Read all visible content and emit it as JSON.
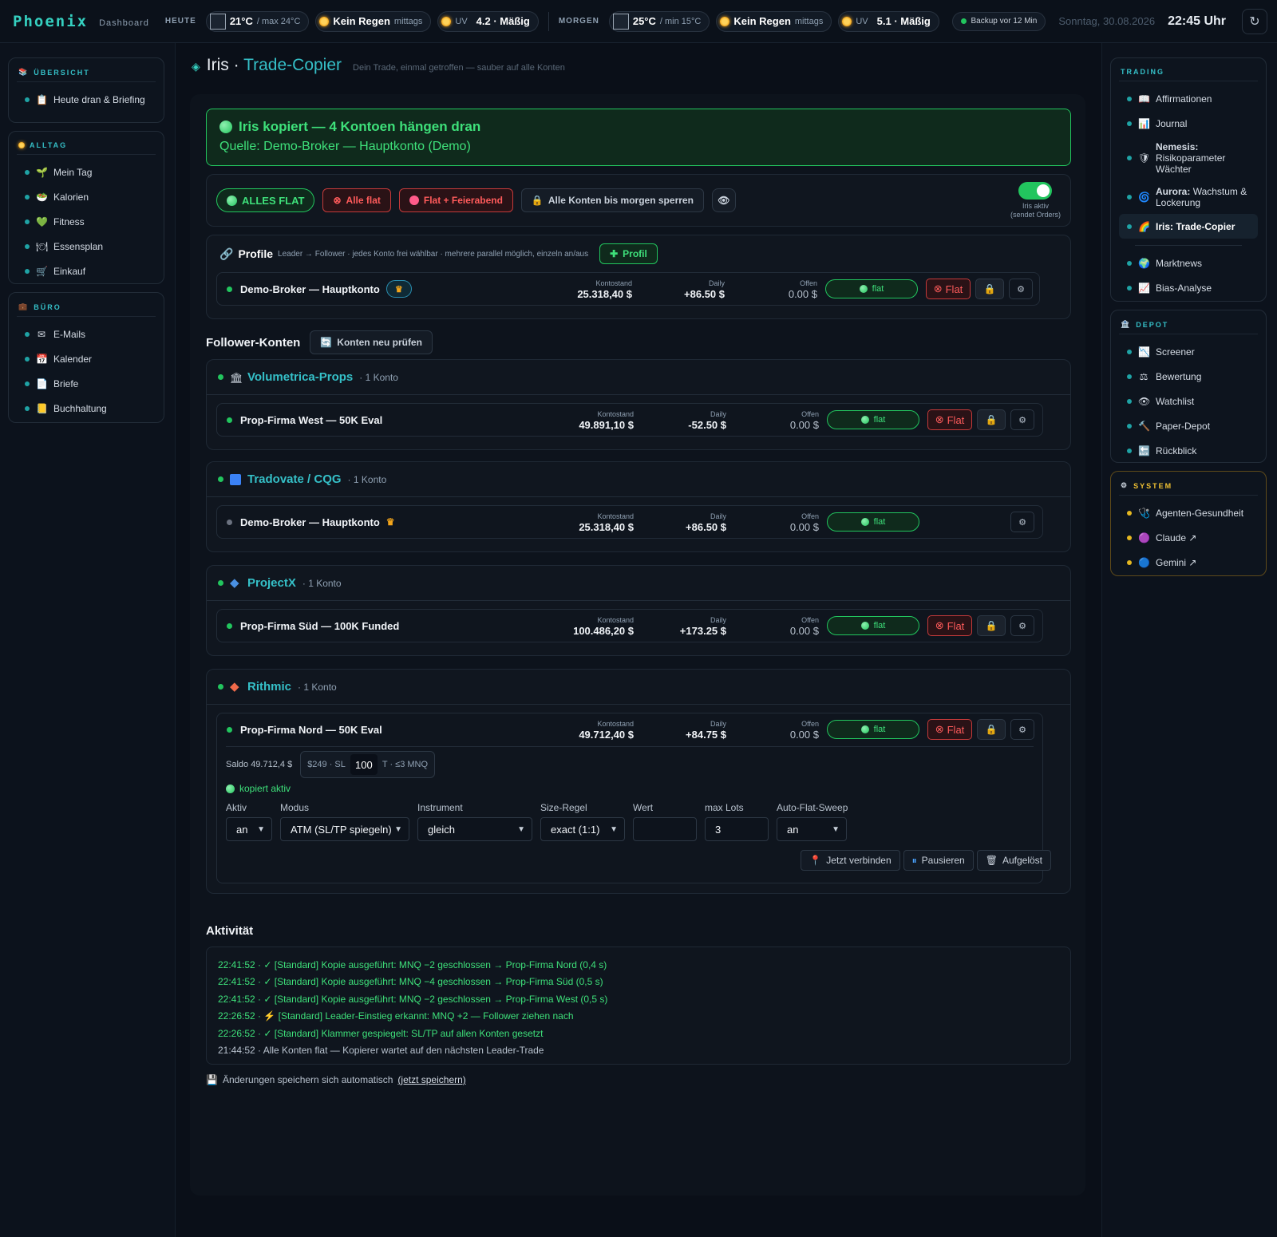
{
  "topbar": {
    "logo": "Phoenix",
    "logo_sub": "Dashboard",
    "today_label": "HEUTE",
    "today_temp": "21°C",
    "today_temp_sub": "/ max 24°C",
    "today_rain": "Kein Regen",
    "today_rain_sub": "mittags",
    "today_uv_label": "UV",
    "today_uv": "4.2 · Mäßig",
    "tomorrow_label": "MORGEN",
    "tomorrow_temp": "25°C",
    "tomorrow_temp_sub": "/ min 15°C",
    "tomorrow_rain": "Kein Regen",
    "tomorrow_rain_sub": "mittags",
    "tomorrow_uv_label": "UV",
    "tomorrow_uv": "5.1 · Mäßig",
    "backup": "Backup vor 12 Min",
    "date": "Sonntag, 30.08.2026",
    "time": "22:45 Uhr",
    "refresh_icon": "↻"
  },
  "left_nav": {
    "overview": {
      "title": "ÜBERSICHT",
      "items": [
        {
          "icon": "📋",
          "label": "Heute dran & Briefing"
        }
      ]
    },
    "alltag": {
      "title": "ALLTAG",
      "items": [
        {
          "icon": "🌱",
          "label": "Mein Tag"
        },
        {
          "icon": "🥗",
          "label": "Kalorien"
        },
        {
          "icon": "💚",
          "label": "Fitness"
        },
        {
          "icon": "🍽",
          "label": "Essensplan"
        },
        {
          "icon": "🛒",
          "label": "Einkauf"
        }
      ]
    },
    "buero": {
      "title": "BÜRO",
      "items": [
        {
          "icon": "✉",
          "label": "E-Mails"
        },
        {
          "icon": "📅",
          "label": "Kalender"
        },
        {
          "icon": "📄",
          "label": "Briefe"
        },
        {
          "icon": "📒",
          "label": "Buchhaltung"
        }
      ]
    }
  },
  "right_nav": {
    "trading": {
      "title": "TRADING",
      "items": [
        {
          "icon": "📖",
          "label": "Affirmationen",
          "bold": ""
        },
        {
          "icon": "📊",
          "label": "Journal",
          "bold": ""
        },
        {
          "icon": "🛡",
          "bold": "Nemesis:",
          "label": "Risikoparameter Wächter"
        },
        {
          "icon": "🌀",
          "bold": "Aurora:",
          "label": "Wachstum & Lockerung"
        },
        {
          "icon": "🌈",
          "bold": "Iris:",
          "label": "Trade-Copier"
        },
        {
          "icon": "🌍",
          "label": "Marktnews",
          "bold": ""
        },
        {
          "icon": "📈",
          "label": "Bias-Analyse",
          "bold": ""
        }
      ]
    },
    "depot": {
      "title": "DEPOT",
      "items": [
        {
          "icon": "📉",
          "label": "Screener"
        },
        {
          "icon": "⚖",
          "label": "Bewertung"
        },
        {
          "icon": "👁",
          "label": "Watchlist"
        },
        {
          "icon": "🔨",
          "label": "Paper-Depot"
        },
        {
          "icon": "🔙",
          "label": "Rückblick"
        }
      ]
    },
    "system": {
      "title": "SYSTEM",
      "items": [
        {
          "icon": "🩺",
          "label": "Agenten-Gesundheit"
        },
        {
          "icon": "🟣",
          "label": "Claude ↗"
        },
        {
          "icon": "🔵",
          "label": "Gemini ↗"
        }
      ]
    }
  },
  "page": {
    "title_prefix": "Iris ·",
    "title_main": "Trade-Copier",
    "subtitle": "Dein Trade, einmal getroffen — sauber auf alle Konten"
  },
  "banner": {
    "line1": "Iris kopiert — 4 Kontoen hängen dran",
    "line2": "Quelle: Demo-Broker — Hauptkonto (Demo)"
  },
  "actions": {
    "alles_flat": "ALLES FLAT",
    "alle_flat": "Alle flat",
    "flat_feierabend": "Flat + Feierabend",
    "sperren": "Alle Konten bis morgen sperren",
    "toggle_label1": "Iris aktiv",
    "toggle_label2": "(sendet Orders)"
  },
  "profile": {
    "title": "Profile",
    "desc": "Leader → Follower · jedes Konto frei wählbar · mehrere parallel möglich, einzeln an/aus",
    "add": "Profil",
    "leader": {
      "name": "Demo-Broker — Hauptkonto",
      "balance": "25.318,40 $",
      "daily": "+86.50 $",
      "open": "0.00 $"
    }
  },
  "labels": {
    "kontostand": "Kontostand",
    "daily": "Daily",
    "offen": "Offen",
    "flat_chip": "flat",
    "flat_btn": "Flat",
    "lock": "🔒",
    "gear": "⚙"
  },
  "followers": {
    "title": "Follower-Konten",
    "recheck": "Konten neu prüfen",
    "groups": [
      {
        "name": "Volumetrica-Props",
        "count": "· 1 Konto",
        "account": {
          "name": "Prop-Firma West — 50K Eval",
          "balance": "49.891,10 $",
          "daily": "-52.50 $",
          "open": "0.00 $"
        }
      },
      {
        "name": "Tradovate / CQG",
        "count": "· 1 Konto",
        "account": {
          "name": "Demo-Broker — Hauptkonto",
          "balance": "25.318,40 $",
          "daily": "+86.50 $",
          "open": "0.00 $"
        }
      },
      {
        "name": "ProjectX",
        "count": "· 1 Konto",
        "account": {
          "name": "Prop-Firma Süd — 100K Funded",
          "balance": "100.486,20 $",
          "daily": "+173.25 $",
          "open": "0.00 $"
        }
      },
      {
        "name": "Rithmic",
        "count": "· 1 Konto",
        "account": {
          "name": "Prop-Firma Nord — 50K Eval",
          "balance": "49.712,40 $",
          "daily": "+84.75 $",
          "open": "0.00 $"
        }
      }
    ]
  },
  "detail": {
    "saldo": "Saldo 49.712,4 $",
    "sl_prefix": "$249 · SL",
    "sl_value": "100",
    "sl_suffix": "T · ≤3 MNQ",
    "kopiert": "kopiert aktiv",
    "fields": {
      "aktiv": {
        "label": "Aktiv",
        "value": "an"
      },
      "modus": {
        "label": "Modus",
        "value": "ATM (SL/TP spiegeln)"
      },
      "instrument": {
        "label": "Instrument",
        "value": "gleich"
      },
      "size": {
        "label": "Size-Regel",
        "value": "exact (1:1)"
      },
      "wert": {
        "label": "Wert",
        "value": ""
      },
      "maxlots": {
        "label": "max Lots",
        "value": "3"
      },
      "sweep": {
        "label": "Auto-Flat-Sweep",
        "value": "an"
      }
    },
    "buttons": {
      "connect": "Jetzt verbinden",
      "pause": "Pausieren",
      "dissolve": "Aufgelöst"
    }
  },
  "activity": {
    "title": "Aktivität",
    "lines": [
      "22:41:52 · ✓ [Standard] Kopie ausgeführt: MNQ −2 geschlossen → Prop-Firma Nord (0,4 s)",
      "22:41:52 · ✓ [Standard] Kopie ausgeführt: MNQ −4 geschlossen → Prop-Firma Süd (0,5 s)",
      "22:41:52 · ✓ [Standard] Kopie ausgeführt: MNQ −2 geschlossen → Prop-Firma West (0,5 s)",
      "22:26:52 · ⚡ [Standard] Leader-Einstieg erkannt: MNQ +2 — Follower ziehen nach",
      "22:26:52 · ✓ [Standard] Klammer gespiegelt: SL/TP auf allen Konten gesetzt",
      "21:44:52 · Alle Konten flat — Kopierer wartet auf den nächsten Leader-Trade"
    ]
  },
  "savenote": {
    "text": "Änderungen speichern sich automatisch",
    "link": "(jetzt speichern)"
  }
}
